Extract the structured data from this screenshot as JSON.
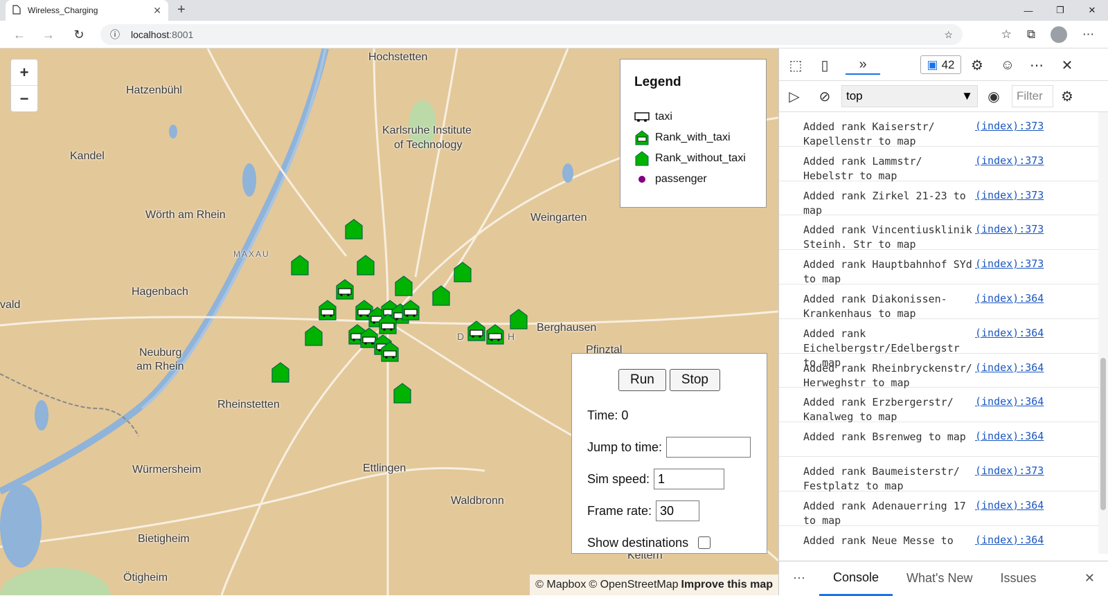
{
  "browser": {
    "tab_title": "Wireless_Charging",
    "tab_close": "✕",
    "new_tab": "+",
    "url_host": "localhost",
    "url_port": ":8001"
  },
  "map": {
    "labels": [
      {
        "text": "Hochstetten"
      },
      {
        "text": "Hatzenbühl"
      },
      {
        "text": "Karlsruhe Institute"
      },
      {
        "text": "of Technology"
      },
      {
        "text": "Kandel"
      },
      {
        "text": "Wörth am Rhein"
      },
      {
        "text": "Weingarten"
      },
      {
        "text": "MAXAU"
      },
      {
        "text": "Hagenbach"
      },
      {
        "text": "vald"
      },
      {
        "text": "Berghausen"
      },
      {
        "text": "Pfinztal"
      },
      {
        "text": "Neuburg"
      },
      {
        "text": "am Rhein"
      },
      {
        "text": "Rheinstetten"
      },
      {
        "text": "Würmersheim"
      },
      {
        "text": "Ettlingen"
      },
      {
        "text": "Waldbronn"
      },
      {
        "text": "Bietigheim"
      },
      {
        "text": "Ötigheim"
      },
      {
        "text": "Keltern"
      },
      {
        "text": "D"
      },
      {
        "text": "H"
      }
    ],
    "zoom_in": "+",
    "zoom_out": "−",
    "attribution_mapbox": "© Mapbox",
    "attribution_osm": "© OpenStreetMap",
    "improve": "Improve this map"
  },
  "legend": {
    "title": "Legend",
    "items": [
      "taxi",
      "Rank_with_taxi",
      "Rank_without_taxi",
      "passenger"
    ]
  },
  "controls": {
    "run": "Run",
    "stop": "Stop",
    "time_label": "Time: 0",
    "jump_label": "Jump to time:",
    "jump_value": "",
    "speed_label": "Sim speed:",
    "speed_value": "1",
    "frame_label": "Frame rate:",
    "frame_value": "30",
    "dest_label": "Show destinations",
    "dest_checked": false
  },
  "devtools": {
    "message_count": "42",
    "context": "top",
    "filter_placeholder": "Filter",
    "logs": [
      {
        "msg": "Added rank Kaiserstr/ Kapellenstr to map",
        "src": "(index):373"
      },
      {
        "msg": "Added rank Lammstr/ Hebelstr to map",
        "src": "(index):373"
      },
      {
        "msg": "Added rank Zirkel 21-23 to map",
        "src": "(index):373"
      },
      {
        "msg": "Added rank Vincentiusklinik Steinh. Str to map",
        "src": "(index):373"
      },
      {
        "msg": "Added rank Hauptbahnhof SYd to map",
        "src": "(index):373"
      },
      {
        "msg": "Added rank Diakonissen-Krankenhaus to map",
        "src": "(index):364"
      },
      {
        "msg": "Added rank Eichelbergstr/Edelbergstr to map",
        "src": "(index):364"
      },
      {
        "msg": "Added rank Rheinbryckenstr/ Herweghstr to map",
        "src": "(index):364"
      },
      {
        "msg": "Added rank Erzbergerstr/ Kanalweg to map",
        "src": "(index):364"
      },
      {
        "msg": "Added rank Bsrenweg to map",
        "src": "(index):364"
      },
      {
        "msg": "Added rank Baumeisterstr/ Festplatz to map",
        "src": "(index):373"
      },
      {
        "msg": "Added rank Adenauerring 17 to map",
        "src": "(index):364"
      },
      {
        "msg": "Added rank Neue Messe to",
        "src": "(index):364"
      }
    ],
    "bottom_tabs": [
      "Console",
      "What's New",
      "Issues"
    ],
    "more": "⋯",
    "close": "✕"
  },
  "colors": {
    "map_bg": "#e3c89a",
    "rank_green": "#00b300",
    "passenger_purple": "#800080",
    "link_blue": "#1a56c0",
    "devtools_accent": "#1a73e8"
  }
}
